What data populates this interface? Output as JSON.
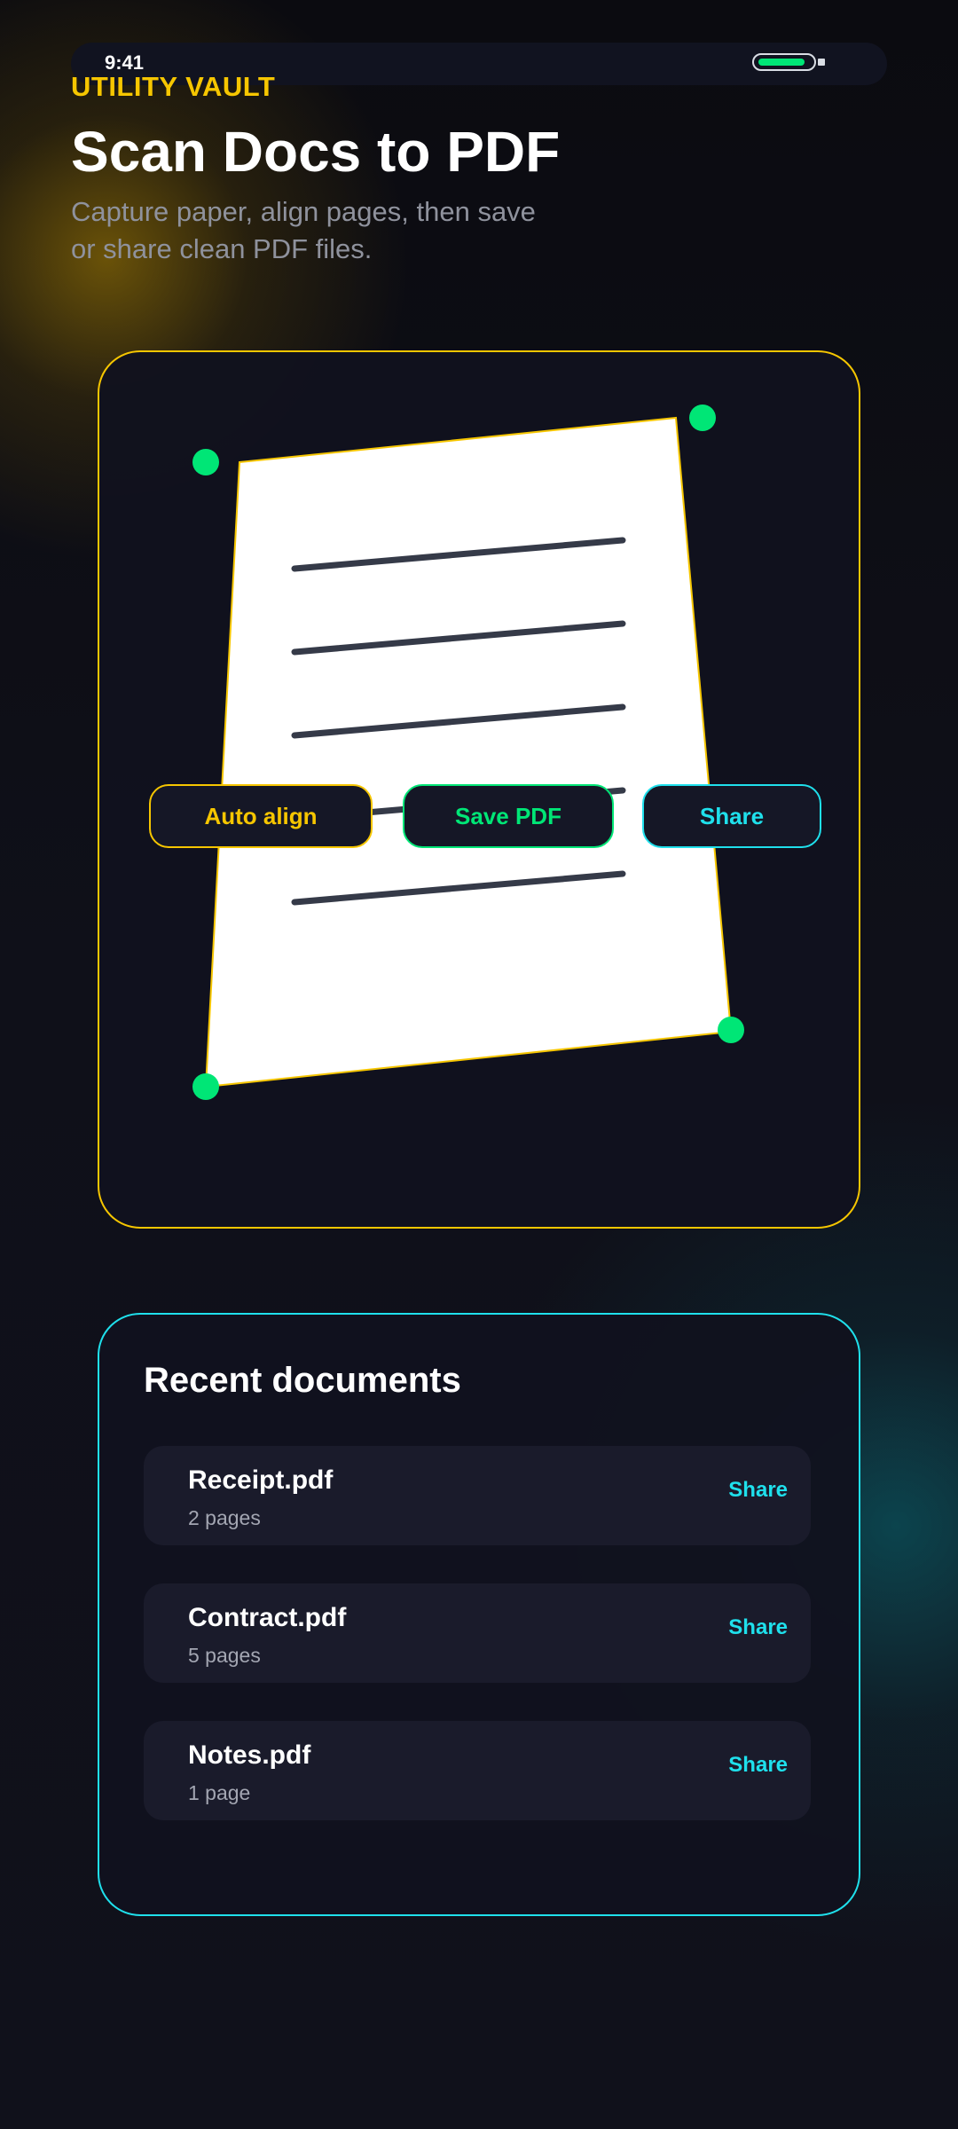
{
  "status_bar": {
    "time": "9:41",
    "battery_level": 0.9
  },
  "header": {
    "eyebrow": "UTILITY VAULT",
    "title": "Scan Docs to PDF",
    "subtitle": "Capture paper, align pages, then save or share clean PDF files."
  },
  "scanner": {
    "actions": {
      "auto_align": "Auto align",
      "save_pdf": "Save PDF",
      "share": "Share"
    }
  },
  "recent": {
    "title": "Recent documents",
    "items": [
      {
        "name": "Receipt.pdf",
        "pages": "2 pages",
        "action": "Share"
      },
      {
        "name": "Contract.pdf",
        "pages": "5 pages",
        "action": "Share"
      },
      {
        "name": "Notes.pdf",
        "pages": "1 page",
        "action": "Share"
      }
    ]
  },
  "colors": {
    "accent_yellow": "#f6c600",
    "accent_green": "#00e676",
    "accent_cyan": "#1fe0ec",
    "background": "#0f1019",
    "card": "#11121e",
    "row": "#1a1b2b"
  }
}
